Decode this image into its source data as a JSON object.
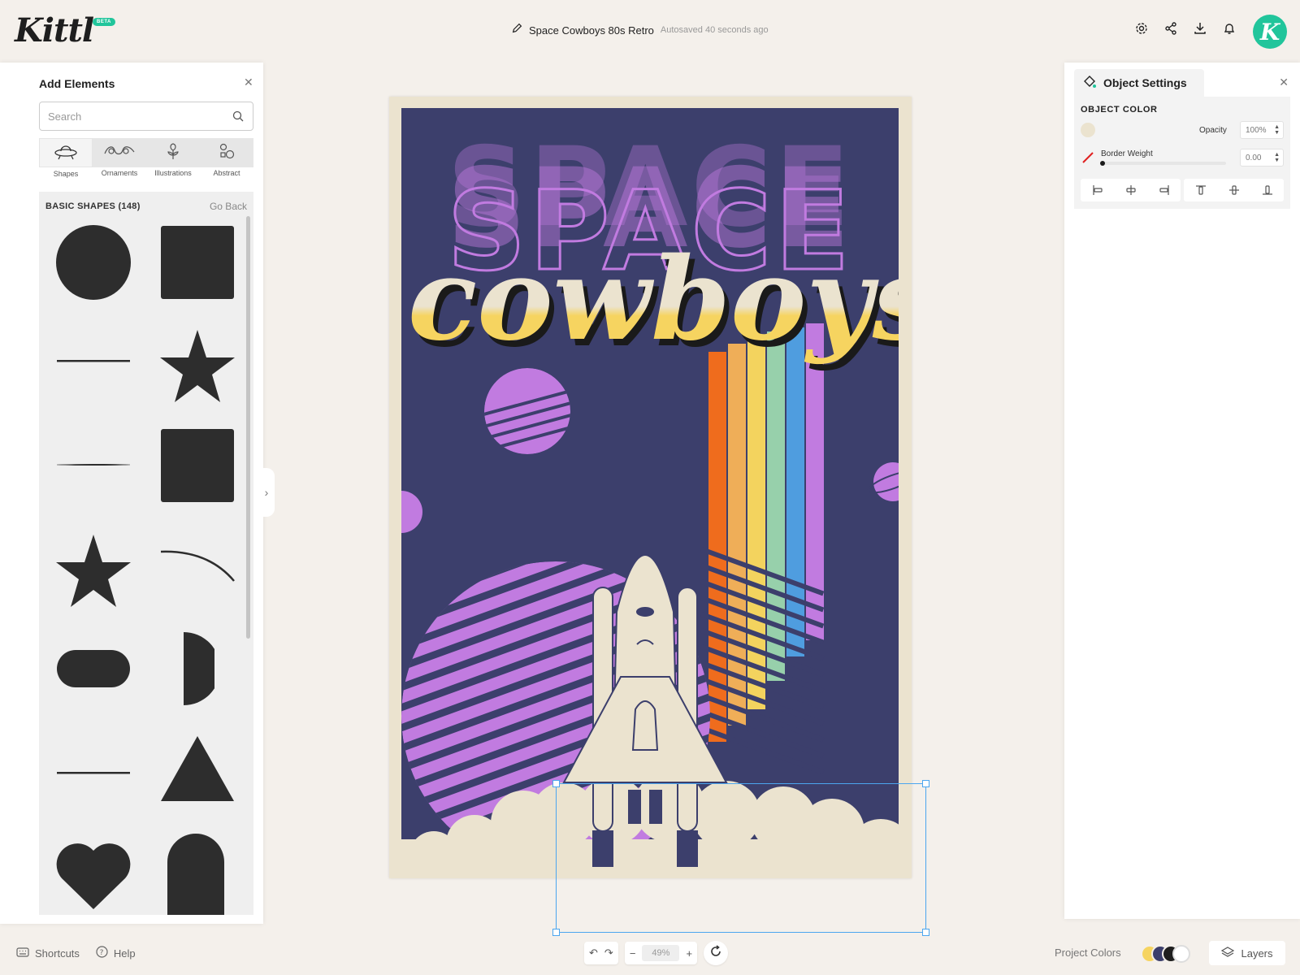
{
  "app": {
    "logo_text": "Kittl",
    "beta_badge": "BETA",
    "avatar_initial": "K"
  },
  "header": {
    "document_title": "Space Cowboys 80s Retro",
    "autosave_status": "Autosaved 40 seconds ago",
    "icons": [
      "pencil-icon",
      "gear-icon",
      "share-icon",
      "download-icon",
      "bell-icon"
    ]
  },
  "left_rail": {
    "icons": [
      "edit-icon",
      "layout-icon",
      "text-icon",
      "shapes-icon",
      "upload-icon",
      "camera-icon",
      "grid-icon"
    ]
  },
  "add_elements": {
    "title": "Add Elements",
    "search": {
      "placeholder": "Search",
      "value": ""
    },
    "categories": [
      {
        "label": "Shapes",
        "icon": "ufo-icon",
        "active": true
      },
      {
        "label": "Ornaments",
        "icon": "ornament-icon",
        "active": false
      },
      {
        "label": "Illustrations",
        "icon": "flower-icon",
        "active": false
      },
      {
        "label": "Abstract",
        "icon": "abstract-icon",
        "active": false
      }
    ],
    "section_title": "BASIC SHAPES (148)",
    "go_back": "Go Back",
    "shapes": [
      "circle",
      "square",
      "line",
      "star",
      "thin-line",
      "square",
      "star",
      "arc",
      "pill",
      "half-circle",
      "line",
      "triangle",
      "heart",
      "arch"
    ]
  },
  "poster": {
    "headline_word": "SPACE",
    "script_word": "cowboys",
    "colors": {
      "background": "#3c3f6c",
      "frame": "#ebe3cf",
      "purple": "#c17be0",
      "cream": "#ebe3cf",
      "yellow": "#f6d460",
      "rainbow": [
        "#ef6c1d",
        "#efae58",
        "#f3d35e",
        "#97d0ab",
        "#4f9ddf",
        "#c17be0"
      ]
    }
  },
  "object_settings": {
    "title": "Object Settings",
    "object_color_label": "OBJECT COLOR",
    "swatch_color": "#ebe3cf",
    "opacity_label": "Opacity",
    "opacity_value": "100%",
    "border_weight_label": "Border Weight",
    "border_weight_value": "0.00",
    "align_buttons": [
      "align-left-icon",
      "align-center-h-icon",
      "align-right-icon",
      "align-top-icon",
      "align-center-v-icon",
      "align-bottom-icon"
    ]
  },
  "bottom": {
    "shortcuts": "Shortcuts",
    "help": "Help",
    "zoom": "49%",
    "project_colors_label": "Project Colors",
    "project_colors": [
      "#f6d460",
      "#3c3f6c",
      "#1e1e1e",
      "#ffffff"
    ],
    "layers": "Layers"
  }
}
